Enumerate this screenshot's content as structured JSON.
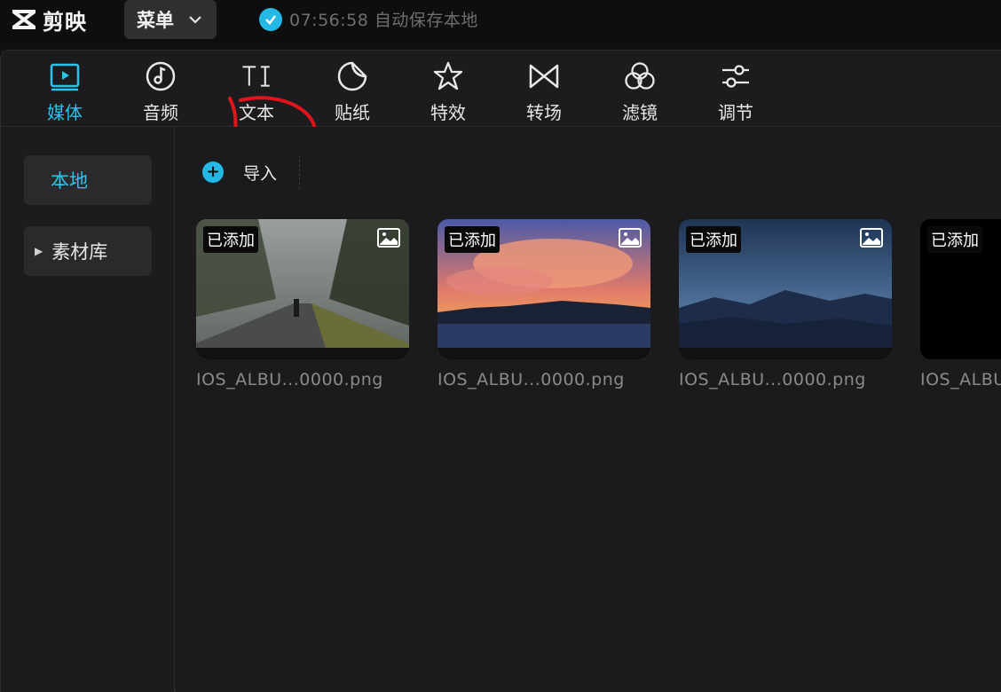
{
  "app": {
    "name": "剪映",
    "menu_label": "菜单",
    "save_status": "07:56:58 自动保存本地",
    "accent_color": "#29c3ee",
    "annotation_color": "#e0151c"
  },
  "toolbar": {
    "tabs": [
      {
        "label": "媒体",
        "icon": "media-play-icon",
        "active": true
      },
      {
        "label": "音频",
        "icon": "music-note-icon",
        "active": false
      },
      {
        "label": "文本",
        "icon": "text-ti-icon",
        "active": false
      },
      {
        "label": "贴纸",
        "icon": "sticker-icon",
        "active": false
      },
      {
        "label": "特效",
        "icon": "star-effect-icon",
        "active": false
      },
      {
        "label": "转场",
        "icon": "transition-bowtie-icon",
        "active": false
      },
      {
        "label": "滤镜",
        "icon": "filter-circles-icon",
        "active": false
      },
      {
        "label": "调节",
        "icon": "adjust-sliders-icon",
        "active": false
      }
    ]
  },
  "sidebar": {
    "items": [
      {
        "label": "本地",
        "active": true
      },
      {
        "label": "素材库",
        "active": false,
        "collapsed": true
      }
    ]
  },
  "content": {
    "import_label": "导入",
    "media": [
      {
        "badge": "已添加",
        "filename": "IOS_ALBU...0000.png",
        "scene": "foggy-road"
      },
      {
        "badge": "已添加",
        "filename": "IOS_ALBU...0000.png",
        "scene": "sunset-clouds"
      },
      {
        "badge": "已添加",
        "filename": "IOS_ALBU...0000.png",
        "scene": "starry-mountains"
      },
      {
        "badge": "已添加",
        "filename": "IOS_ALBU",
        "scene": "black"
      }
    ]
  }
}
